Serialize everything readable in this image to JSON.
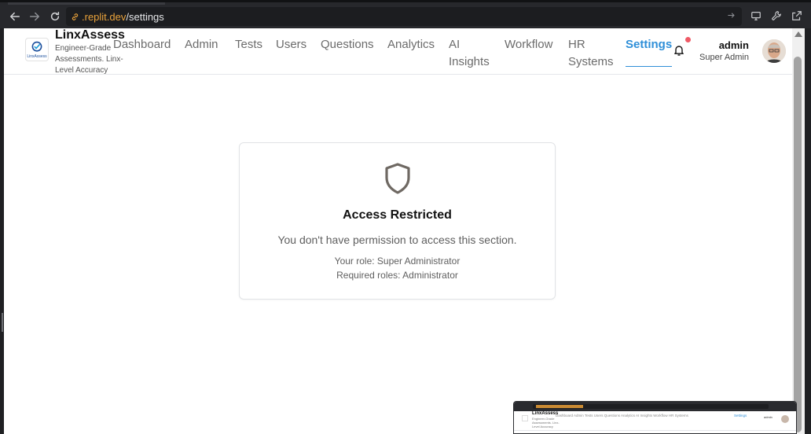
{
  "browser": {
    "url_host": ".replit.dev",
    "url_path": "/settings"
  },
  "app": {
    "brand_name": "LinxAssess",
    "brand_tagline": "Engineer-Grade Assessments. Linx-Level Accuracy",
    "logo_text": "LinxAssess",
    "accent_color": "#2f8fd8"
  },
  "nav": {
    "items": [
      {
        "label": "Dashboard"
      },
      {
        "label": "Admin"
      },
      {
        "label": "Tests"
      },
      {
        "label": "Users"
      },
      {
        "label": "Questions"
      },
      {
        "label": "Analytics"
      },
      {
        "label": "AI Insights"
      },
      {
        "label": "Workflow"
      },
      {
        "label": "HR Systems"
      },
      {
        "label": "Settings",
        "active": true
      }
    ]
  },
  "user": {
    "name": "admin",
    "role": "Super Admin"
  },
  "notifications": {
    "has_unread": true,
    "icon": "bell-icon"
  },
  "access_card": {
    "icon": "shield-icon",
    "title": "Access Restricted",
    "message": "You don't have permission to access this section.",
    "your_role": "Your role: Super Administrator",
    "required_roles": "Required roles: Administrator"
  },
  "mini_preview": {
    "brand_name": "LinxAssess",
    "brand_tagline": "Engineer-Grade Assessments. Linx-Level Accuracy",
    "nav_text": "Dashboard   Admin   Tests   Users   Questions   Analytics   AI Insights   Workflow   HR Systems",
    "active_label": "Settings",
    "user_name": "admin",
    "user_role": "Super Admin"
  }
}
